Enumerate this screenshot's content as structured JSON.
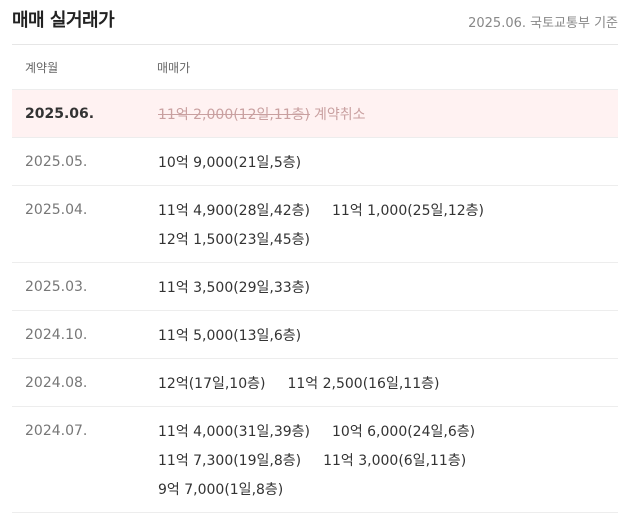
{
  "header": {
    "title": "매매 실거래가",
    "source": "2025.06. 국토교통부 기준"
  },
  "columns": {
    "month": "계약월",
    "price": "매매가"
  },
  "rows": [
    {
      "month": "2025.06.",
      "cancelled": true,
      "deals": [
        [
          "11억 2,000(12일,11층)"
        ]
      ],
      "cancel_label": "계약취소"
    },
    {
      "month": "2025.05.",
      "deals": [
        [
          "10억 9,000(21일,5층)"
        ]
      ]
    },
    {
      "month": "2025.04.",
      "deals": [
        [
          "11억 4,900(28일,42층)",
          "11억 1,000(25일,12층)"
        ],
        [
          "12억 1,500(23일,45층)"
        ]
      ]
    },
    {
      "month": "2025.03.",
      "deals": [
        [
          "11억 3,500(29일,33층)"
        ]
      ]
    },
    {
      "month": "2024.10.",
      "deals": [
        [
          "11억 5,000(13일,6층)"
        ]
      ]
    },
    {
      "month": "2024.08.",
      "deals": [
        [
          "12억(17일,10층)",
          "11억 2,500(16일,11층)"
        ]
      ]
    },
    {
      "month": "2024.07.",
      "deals": [
        [
          "11억 4,000(31일,39층)",
          "10억 6,000(24일,6층)"
        ],
        [
          "11억 7,300(19일,8층)",
          "11억 3,000(6일,11층)"
        ],
        [
          "9억 7,000(1일,8층)"
        ]
      ]
    }
  ]
}
